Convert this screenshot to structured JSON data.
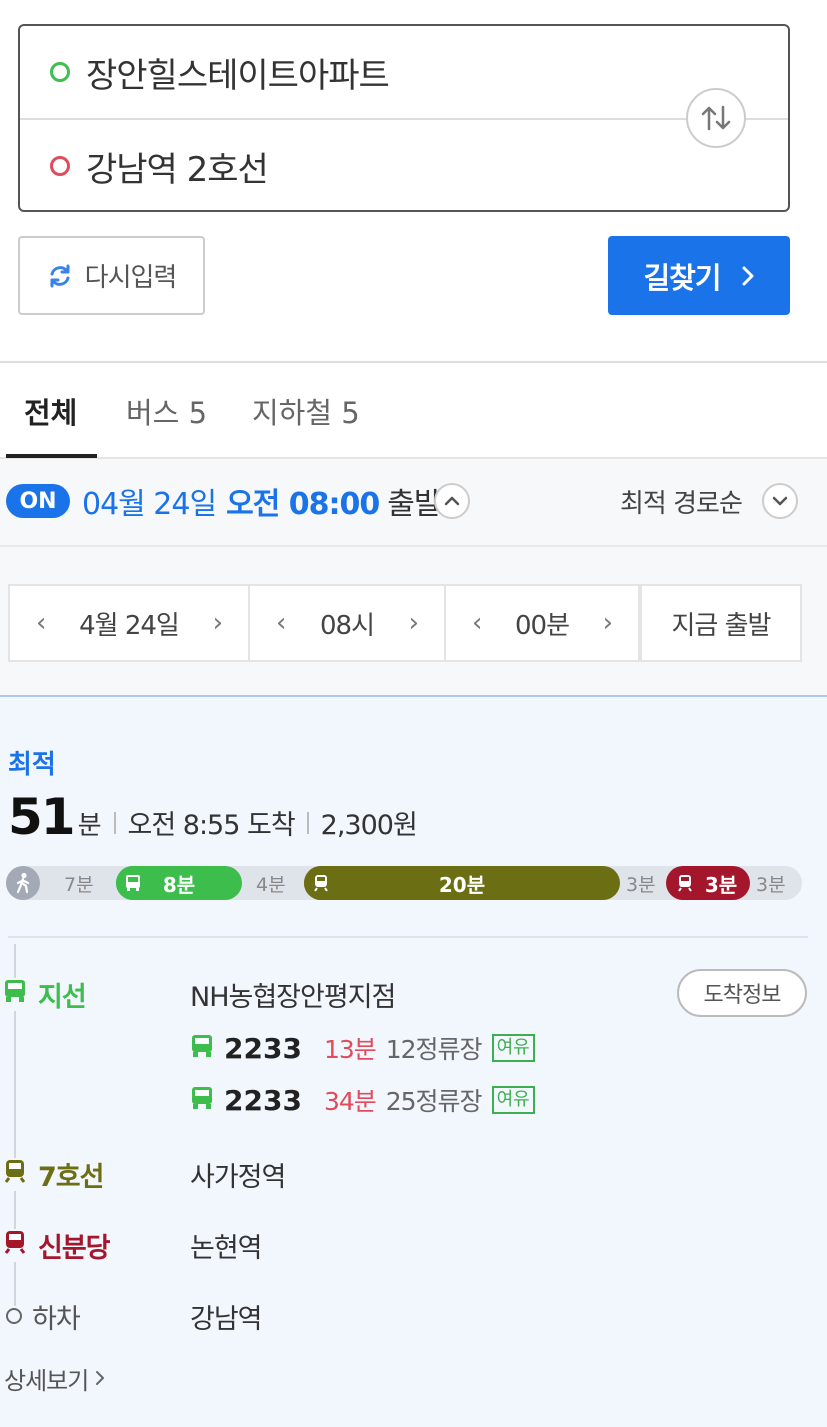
{
  "search": {
    "origin": "장안힐스테이트아파트",
    "destination": "강남역 2호선"
  },
  "buttons": {
    "reset_label": "다시입력",
    "find_label": "길찾기"
  },
  "tabs": [
    {
      "label": "전체",
      "active": true
    },
    {
      "label": "버스 5",
      "active": false
    },
    {
      "label": "지하철 5",
      "active": false
    }
  ],
  "departure": {
    "badge": "ON",
    "date": "04월 24일",
    "time": "오전 08:00",
    "suffix": "출발",
    "sort_label": "최적 경로순"
  },
  "picker": {
    "date": "4월 24일",
    "hour": "08시",
    "minute": "00분",
    "now_label": "지금 출발"
  },
  "route": {
    "label": "최적",
    "duration_value": "51",
    "duration_unit": "분",
    "arrival": "오전 8:55 도착",
    "fare": "2,300원",
    "segments": [
      {
        "kind": "walk",
        "label": "7분"
      },
      {
        "kind": "bus",
        "label": "8분",
        "color": "#3dbd4c"
      },
      {
        "kind": "walk",
        "label": "4분"
      },
      {
        "kind": "subway",
        "label": "20분",
        "color": "#6b6e12"
      },
      {
        "kind": "walk",
        "label": "3분"
      },
      {
        "kind": "subway",
        "label": "3분",
        "color": "#a3162b"
      },
      {
        "kind": "walk",
        "label": "3분"
      }
    ],
    "steps": [
      {
        "mode": "지선",
        "color": "#3dbd4c",
        "stop": "NH농협장안평지점",
        "action": "도착정보",
        "buses": [
          {
            "number": "2233",
            "minutes": "13분",
            "stops": "12정류장",
            "status": "여유"
          },
          {
            "number": "2233",
            "minutes": "34분",
            "stops": "25정류장",
            "status": "여유"
          }
        ]
      },
      {
        "mode": "7호선",
        "color": "#6b6e12",
        "stop": "사가정역"
      },
      {
        "mode": "신분당",
        "color": "#a3162b",
        "stop": "논현역"
      },
      {
        "mode": "하차",
        "color": "#555555",
        "stop": "강남역"
      }
    ],
    "detail_label": "상세보기"
  },
  "colors": {
    "accent": "#1a73e8",
    "bus_green": "#3dbd4c",
    "line7": "#6b6e12",
    "shinbundang": "#a3162b",
    "late_red": "#e04c5c"
  },
  "icons": [
    "swap-icon",
    "refresh-icon",
    "chevron-right-icon",
    "chevron-up-icon",
    "chevron-down-icon",
    "walk-icon",
    "bus-icon",
    "subway-icon"
  ]
}
